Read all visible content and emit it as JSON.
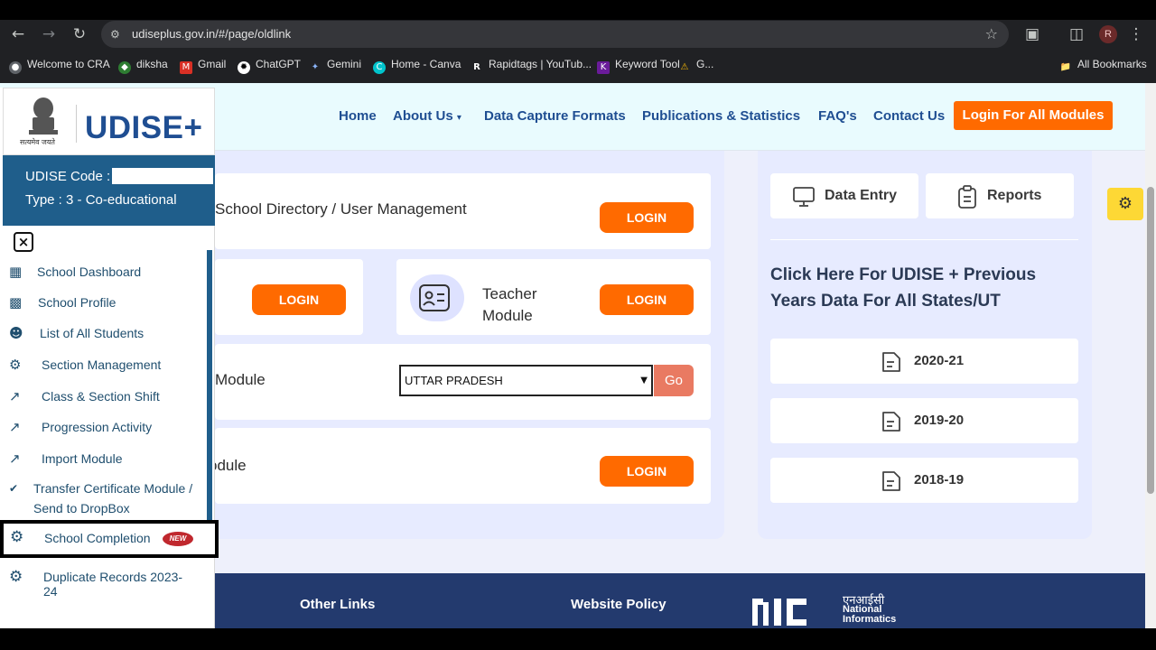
{
  "browser": {
    "url": "udiseplus.gov.in/#/page/oldlink",
    "avatar_letter": "R",
    "bookmarks": [
      "Welcome to CRA",
      "diksha",
      "Gmail",
      "ChatGPT",
      "Gemini",
      "Home - Canva",
      "Rapidtags | YouTub...",
      "Keyword Tool",
      "G...",
      "All Bookmarks"
    ]
  },
  "header": {
    "nav": [
      "Home",
      "About Us",
      "Data Capture Formats",
      "Publications & Statistics",
      "FAQ's",
      "Contact Us"
    ],
    "login_all": "Login For All Modules"
  },
  "sidebar": {
    "logo_text": "UDISE+",
    "emblem_caption": "सत्यमेव जयते",
    "udise_code_label": "UDISE Code :",
    "type_label": "Type : 3 - Co-educational",
    "items": [
      {
        "label": "School Dashboard",
        "icon": "grid-icon"
      },
      {
        "label": "School Profile",
        "icon": "building-icon"
      },
      {
        "label": "List of All Students",
        "icon": "students-icon"
      },
      {
        "label": "Section Management",
        "icon": "gears-icon"
      },
      {
        "label": "Class & Section Shift",
        "icon": "chart-line-icon"
      },
      {
        "label": "Progression Activity",
        "icon": "chart-line-icon"
      },
      {
        "label": "Import Module",
        "icon": "chart-line-icon"
      },
      {
        "label_line1": "Transfer Certificate Module /",
        "label_line2": "Send to DropBox",
        "icon": "badge-icon"
      },
      {
        "label": "School Completion",
        "icon": "cog-badge-icon",
        "badge": "NEW"
      },
      {
        "label": "Duplicate Records 2023-",
        "label_cut": "24",
        "icon": "cog-badge-icon"
      }
    ]
  },
  "modules": {
    "school_directory": "School Directory / User Management",
    "teacher_line1": "Teacher",
    "teacher_line2": "Module",
    "module_partial": "Module",
    "module_partial2": "odule",
    "login": "LOGIN",
    "state_select": "UTTAR PRADESH",
    "go": "Go"
  },
  "right_panel": {
    "data_entry": "Data Entry",
    "reports": "Reports",
    "heading": "Click Here For UDISE + Previous Years Data For All States/UT",
    "years": [
      "2020-21",
      "2019-20",
      "2018-19"
    ]
  },
  "footer": {
    "other_links": "Other Links",
    "website_policy": "Website Policy",
    "nic_hindi": "एनआईसी",
    "nic_line1": "National",
    "nic_line2": "Informatics"
  }
}
